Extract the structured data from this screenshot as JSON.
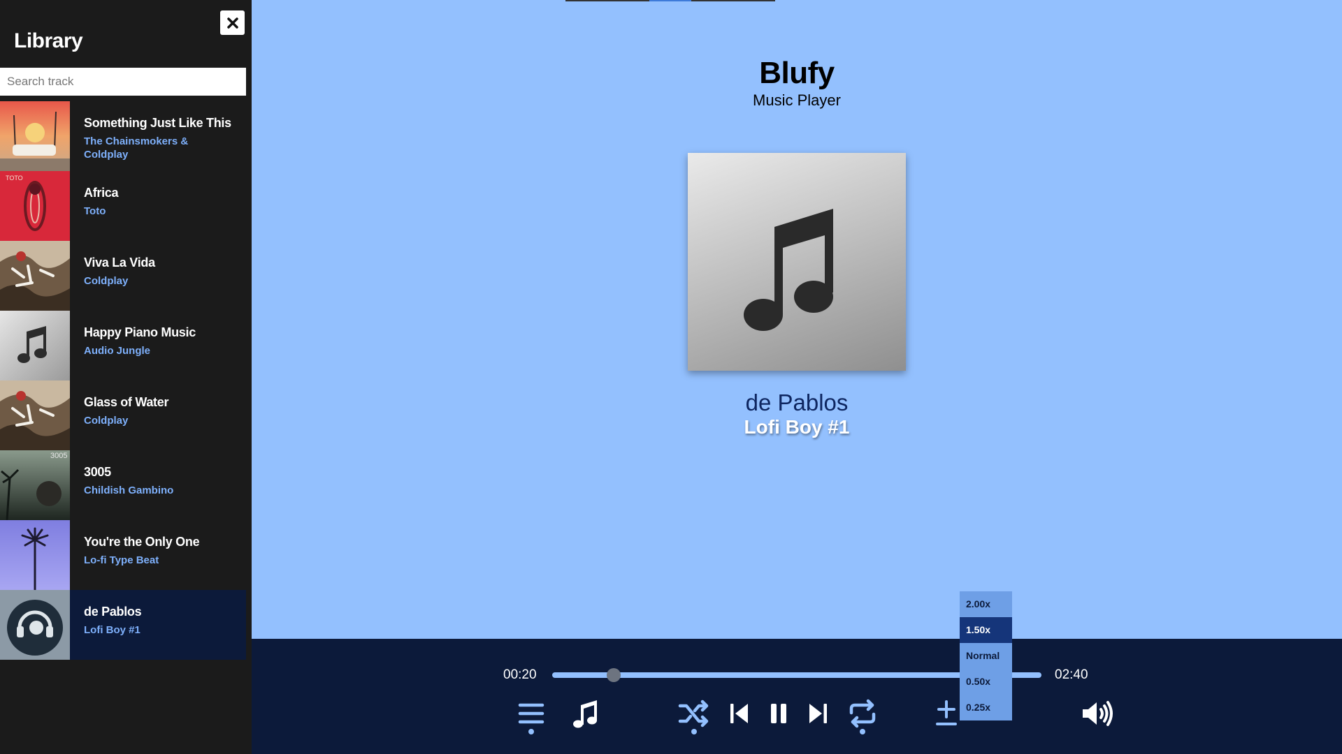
{
  "sidebar": {
    "title": "Library",
    "search_placeholder": "Search track",
    "tracks": [
      {
        "title": "Something Just Like This",
        "artist": "The Chainsmokers & Coldplay"
      },
      {
        "title": "Africa",
        "artist": "Toto"
      },
      {
        "title": "Viva La Vida",
        "artist": "Coldplay"
      },
      {
        "title": "Happy Piano Music",
        "artist": "Audio Jungle"
      },
      {
        "title": "Glass of Water",
        "artist": "Coldplay"
      },
      {
        "title": "3005",
        "artist": "Childish Gambino"
      },
      {
        "title": "You're the Only One",
        "artist": "Lo-fi Type Beat"
      },
      {
        "title": "de Pablos",
        "artist": "Lofi Boy #1"
      }
    ],
    "active_index": 7,
    "cover_text": {
      "toto": "TOTO",
      "gambino": "3005"
    }
  },
  "header": {
    "title": "Blufy",
    "subtitle": "Music Player"
  },
  "now_playing": {
    "artist": "de Pablos",
    "title": "Lofi Boy #1",
    "cover_icon": "music-note-icon"
  },
  "player": {
    "current_time": "00:20",
    "total_time": "02:40",
    "progress": 0.125,
    "controls": [
      "menu-icon",
      "music-note-icon",
      "shuffle-icon",
      "previous-icon",
      "pause-icon",
      "next-icon",
      "repeat-icon",
      "playback-speed-icon",
      "volume-icon"
    ],
    "speed_options": [
      "2.00x",
      "1.50x",
      "Normal",
      "0.50x",
      "0.25x"
    ],
    "selected_speed": "1.50x"
  },
  "colors": {
    "background": "#93c0fe",
    "sidebar": "#1b1b1b",
    "player_bar": "#0c1a3a",
    "accent": "#7eb0fb",
    "artist_text": "#0e2660"
  }
}
